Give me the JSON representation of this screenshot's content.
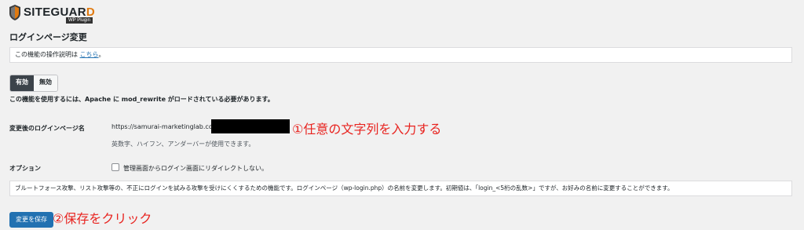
{
  "logo": {
    "text_main": "SITEGUAR",
    "text_d": "D",
    "sub": "WP Plugin"
  },
  "page_title": "ログインページ変更",
  "notice": {
    "text": "この機能の操作説明は ",
    "link": "こちら",
    "suffix": "。"
  },
  "toggle": {
    "on": "有効",
    "off": "無効"
  },
  "requirement": "この機能を使用するには、Apache に mod_rewrite がロードされている必要があります。",
  "login_page": {
    "label": "変更後のログインページ名",
    "url_prefix": "https://samurai-marketinglab.com",
    "hint": "英数字、ハイフン、アンダーバーが使用できます。"
  },
  "option": {
    "label": "オプション",
    "checkbox_label": "管理画面からログイン画面にリダイレクトしない。"
  },
  "description": "ブルートフォース攻撃、リスト攻撃等の、不正にログインを試みる攻撃を受けにくくするための機能です。ログインページ（wp-login.php）の名前を変更します。初期値は、「login_<5桁の乱数>」ですが、お好みの名前に変更することができます。",
  "save_button": "変更を保存",
  "annotations": {
    "step1": "①任意の文字列を入力する",
    "step2": "②保存をクリック"
  },
  "colors": {
    "accent": "#2271b1",
    "annotation": "#e8231f"
  }
}
